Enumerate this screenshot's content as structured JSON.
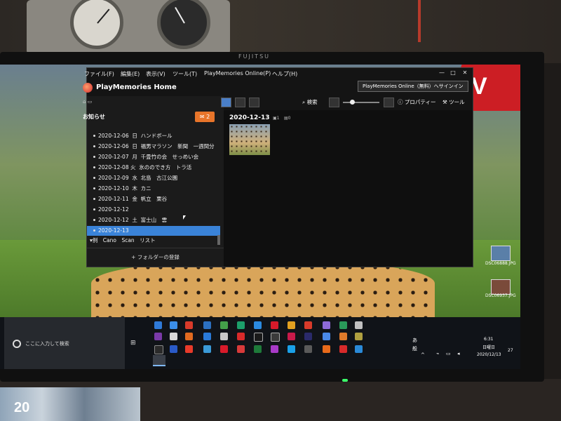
{
  "monitor": {
    "brand": "FUJITSU"
  },
  "books": {
    "label": "20"
  },
  "wallpaper": {
    "logo_text": "V"
  },
  "desktop": {
    "icons": [
      {
        "label": "DSC06888.JPG"
      },
      {
        "label": "DSC06937.JPG"
      }
    ]
  },
  "app": {
    "title": "PlayMemories Home",
    "menu": [
      "ファイル(F)",
      "編集(E)",
      "表示(V)",
      "ツール(T)",
      "PlayMemories Online(P)",
      "ヘルプ(H)"
    ],
    "window_buttons": [
      "—",
      "□",
      "✕"
    ],
    "signin_button": "PlayMemories Online（無料）へサインイン",
    "notice": {
      "label": "お知らせ",
      "count": "2"
    },
    "folders": [
      {
        "date": "2020-12-06",
        "day": "日",
        "name": "ハンドボール"
      },
      {
        "date": "2020-12-06",
        "day": "日",
        "name": "福男マラソン　新聞　一週間分"
      },
      {
        "date": "2020-12-07",
        "day": "月",
        "name": "千畳竹の会　せっめい会"
      },
      {
        "date": "2020-12-08",
        "day": "火",
        "name": "氷ののでき方　トラ活"
      },
      {
        "date": "2020-12-09",
        "day": "水",
        "name": "北島　古江公園"
      },
      {
        "date": "2020-12-10",
        "day": "木",
        "name": "カニ"
      },
      {
        "date": "2020-12-11",
        "day": "金",
        "name": "帆立　栗谷"
      },
      {
        "date": "2020-12-12",
        "day": "",
        "name": ""
      },
      {
        "date": "2020-12-12",
        "day": "土",
        "name": "富士山　雲"
      },
      {
        "date": "2020-12-13",
        "day": "",
        "name": "",
        "selected": true
      }
    ],
    "group_label": "▾例　Cano　Scan　リスト",
    "register_button": "+ フォルダーの登録",
    "toolbar": {
      "search_label": "検索",
      "properties_label": "プロパティー",
      "tools_label": "ツール"
    },
    "content": {
      "date_header": "2020-12-13",
      "photo_count": "1",
      "video_count": "0"
    }
  },
  "taskbar": {
    "search_placeholder": "ここに入力して検索",
    "time": "6:31",
    "day": "日曜日",
    "date": "2020/12/13",
    "ime_a": "あ",
    "ime_kanji": "般",
    "notification_count": "27"
  }
}
